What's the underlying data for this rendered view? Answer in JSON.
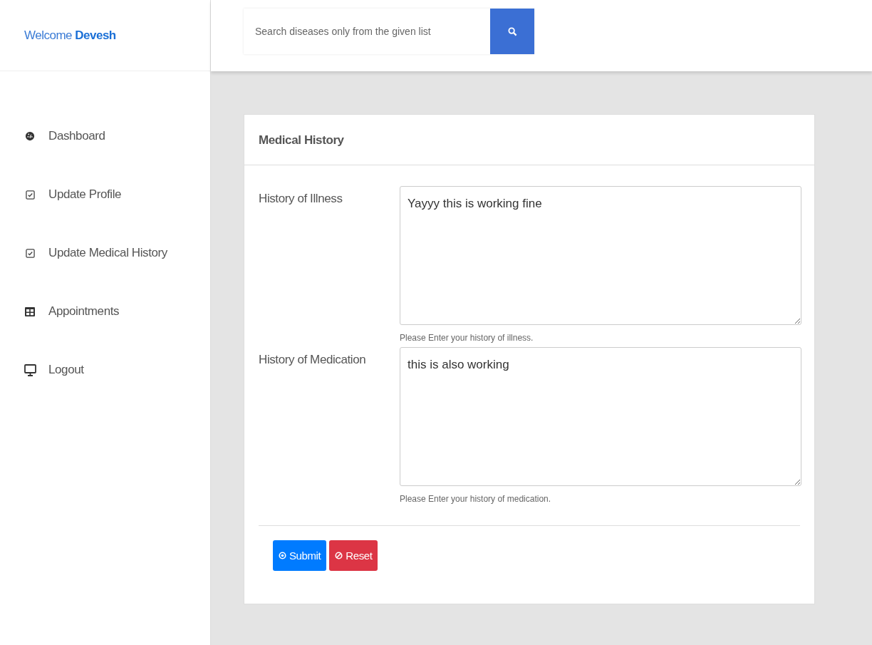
{
  "welcome": {
    "greeting": "Welcome",
    "name": "Devesh"
  },
  "search": {
    "placeholder": "Search diseases only from the given list"
  },
  "sidebar": {
    "items": [
      {
        "label": "Dashboard",
        "kind": "gauge"
      },
      {
        "label": "Update Profile",
        "kind": "checkbox"
      },
      {
        "label": "Update Medical History",
        "kind": "checkbox"
      },
      {
        "label": "Appointments",
        "kind": "table"
      },
      {
        "label": "Logout",
        "kind": "desktop"
      }
    ]
  },
  "card": {
    "title": "Medical History",
    "fields": [
      {
        "label": "History of Illness",
        "value": "Yayyy this is working fine",
        "help": "Please Enter your history of illness."
      },
      {
        "label": "History of Medication",
        "value": "this is also working",
        "help": "Please Enter your history of medication."
      }
    ],
    "buttons": [
      {
        "label": "Submit",
        "kind": "submit"
      },
      {
        "label": "Reset",
        "kind": "reset"
      }
    ]
  }
}
